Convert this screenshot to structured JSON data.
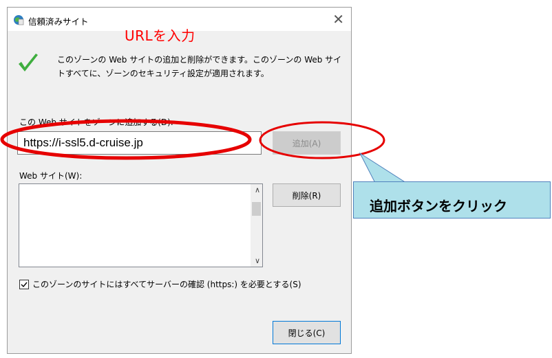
{
  "dialog": {
    "title": "信頼済みサイト",
    "close_glyph": "✕",
    "info_line1": "このゾーンの Web サイトの追加と削除ができます。このゾーンの Web サイ",
    "info_line2": "トすべてに、ゾーンのセキュリティ設定が適用されます。",
    "add_field_label": "この Web サイトをゾーンに追加する(D):",
    "url_value": "https://i-ssl5.d-cruise.jp",
    "add_button": "追加(A)",
    "list_label": "Web サイト(W):",
    "sites": [],
    "remove_button": "削除(R)",
    "https_checkbox_label": "このゾーンのサイトにはすべてサーバーの確認 (https:) を必要とする(S)",
    "https_checked": true,
    "close_button": "閉じる(C)",
    "icons": {
      "title": "globe-shield-icon",
      "info": "checkmark-icon"
    }
  },
  "annotations": {
    "url_note": "URLを入力",
    "callout": "追加ボタンをクリック",
    "highlight_color": "#ff0000",
    "callout_color": "#aee0ea"
  }
}
